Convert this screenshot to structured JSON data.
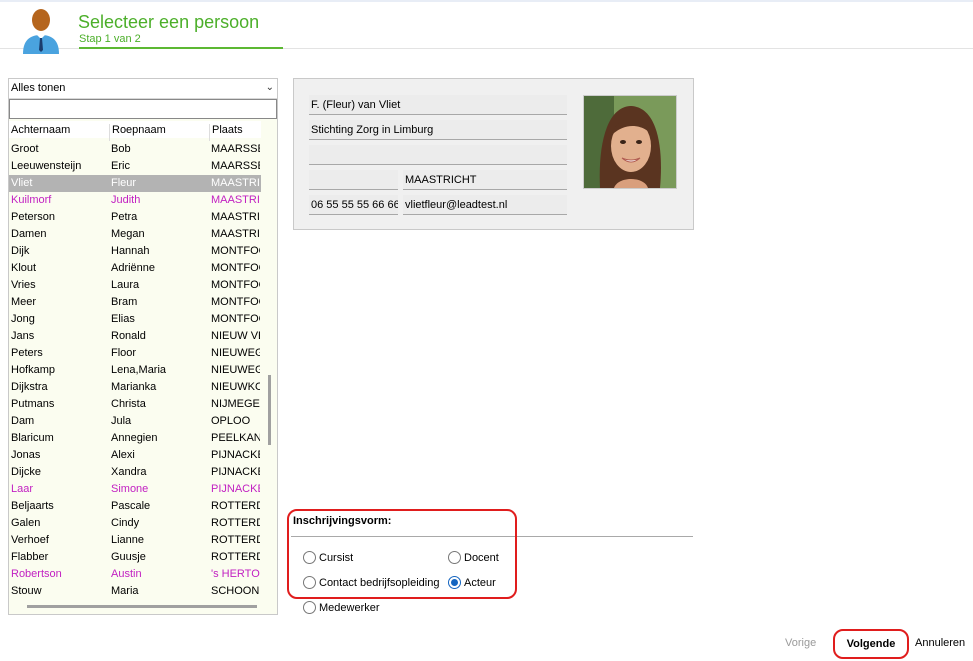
{
  "header": {
    "title": "Selecteer een persoon",
    "step": "Stap 1 van 2",
    "progress_percent": 50
  },
  "filter": {
    "selected": "Alles tonen"
  },
  "search": {
    "value": ""
  },
  "columns": [
    "Achternaam",
    "Roepnaam",
    "Plaats"
  ],
  "persons": [
    {
      "last": "Groot",
      "first": "Bob",
      "city": "MAARSSEN",
      "style": ""
    },
    {
      "last": "Leeuwensteijn",
      "first": "Eric",
      "city": "MAARSSEN",
      "style": ""
    },
    {
      "last": "Vliet",
      "first": "Fleur",
      "city": "MAASTRICHT",
      "style": "sel"
    },
    {
      "last": "Kuilmorf",
      "first": "Judith",
      "city": "MAASTRICHT",
      "style": "pink"
    },
    {
      "last": "Peterson",
      "first": " Petra",
      "city": "MAASTRICHT",
      "style": ""
    },
    {
      "last": "Damen",
      "first": "Megan",
      "city": "MAASTRICHT",
      "style": ""
    },
    {
      "last": "Dijk",
      "first": "Hannah",
      "city": "MONTFOORT",
      "style": ""
    },
    {
      "last": "Klout",
      "first": "Adriënne",
      "city": "MONTFOORT",
      "style": ""
    },
    {
      "last": "Vries",
      "first": "Laura",
      "city": "MONTFOORT",
      "style": ""
    },
    {
      "last": "Meer",
      "first": "Bram",
      "city": "MONTFOORT",
      "style": ""
    },
    {
      "last": "Jong",
      "first": "Elias",
      "city": "MONTFOORT",
      "style": ""
    },
    {
      "last": "Jans",
      "first": " Ronald",
      "city": "NIEUW VENNEP",
      "style": ""
    },
    {
      "last": "Peters",
      "first": "Floor",
      "city": "NIEUWEGEIN",
      "style": ""
    },
    {
      "last": "Hofkamp",
      "first": "Lena,Maria",
      "city": "NIEUWEGEIN",
      "style": ""
    },
    {
      "last": "Dijkstra",
      "first": "Marianka",
      "city": "NIEUWKOOP",
      "style": ""
    },
    {
      "last": "Putmans",
      "first": "Christa",
      "city": "NIJMEGEN",
      "style": ""
    },
    {
      "last": "Dam",
      "first": "Jula",
      "city": "OPLOO",
      "style": ""
    },
    {
      "last": "Blaricum",
      "first": "Annegien",
      "city": "PEELKANT",
      "style": ""
    },
    {
      "last": "Jonas",
      "first": "Alexi",
      "city": "PIJNACKER",
      "style": ""
    },
    {
      "last": "Dijcke",
      "first": "Xandra",
      "city": "PIJNACKER",
      "style": ""
    },
    {
      "last": "Laar",
      "first": "Simone",
      "city": "PIJNACKER",
      "style": "pink"
    },
    {
      "last": "Beljaarts",
      "first": "Pascale",
      "city": "ROTTERDAM",
      "style": "ul"
    },
    {
      "last": "Galen",
      "first": "Cindy",
      "city": "ROTTERDAM",
      "style": ""
    },
    {
      "last": "Verhoef",
      "first": "Lianne",
      "city": "ROTTERDAM",
      "style": ""
    },
    {
      "last": "Flabber",
      "first": "Guusje",
      "city": "ROTTERDAM",
      "style": ""
    },
    {
      "last": "Robertson",
      "first": "Austin",
      "city": "'s HERTOGENBOSCH",
      "style": "pinkplain"
    },
    {
      "last": "Stouw",
      "first": "Maria",
      "city": "SCHOONHOVEN",
      "style": ""
    }
  ],
  "detail": {
    "name": "F. (Fleur) van Vliet",
    "organisation": "Stichting Zorg in Limburg",
    "address": "",
    "postcode": "",
    "city": "MAASTRICHT",
    "phone": "06 55 55 55 66 66",
    "email": "vlietfleur@leadtest.nl"
  },
  "inschrijving": {
    "label": "Inschrijvingsvorm:",
    "options": [
      {
        "label": "Cursist",
        "checked": false
      },
      {
        "label": "Docent",
        "checked": false
      },
      {
        "label": "Contact bedrijfsopleiding",
        "checked": false
      },
      {
        "label": "Acteur",
        "checked": true
      },
      {
        "label": "Medewerker",
        "checked": false
      }
    ]
  },
  "footer": {
    "prev_label": "Vorige",
    "next_label": "Volgende",
    "cancel_label": "Annuleren"
  },
  "colors": {
    "accent_green": "#4caf2a",
    "highlight_red": "#e01d1d",
    "link_pink": "#c221c2",
    "selected_row": "#b3b3b3"
  }
}
